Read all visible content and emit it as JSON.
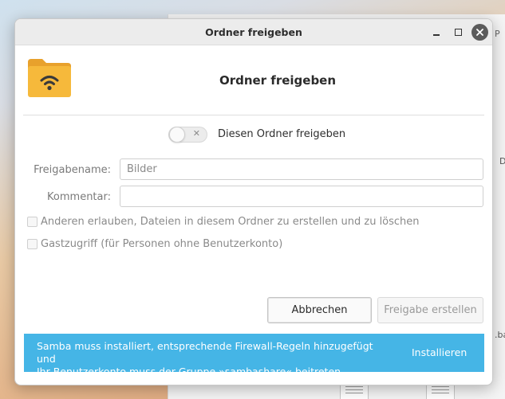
{
  "background": {
    "window_title_fragment": "P",
    "side_letter": "D",
    "side_ext": ".ba"
  },
  "dialog": {
    "title": "Ordner freigeben",
    "heading": "Ordner freigeben",
    "toggle": {
      "label": "Diesen Ordner freigeben",
      "on": false,
      "off_glyph": "✕"
    },
    "fields": {
      "share_name": {
        "label": "Freigabename:",
        "placeholder": "Bilder",
        "value": ""
      },
      "comment": {
        "label": "Kommentar:",
        "placeholder": "",
        "value": ""
      }
    },
    "checks": {
      "allow_others": "Anderen erlauben, Dateien in diesem Ordner zu erstellen und zu löschen",
      "guest_access": "Gastzugriff (für Personen ohne Benutzerkonto)"
    },
    "buttons": {
      "cancel": "Abbrechen",
      "create": "Freigabe erstellen"
    },
    "infobar": {
      "line1": "Samba muss installiert, entsprechende Firewall-Regeln hinzugefügt und",
      "line2": "Ihr Benutzerkonto muss der Gruppe »sambashare« beitreten.",
      "action": "Installieren",
      "color": "#45b5e6"
    },
    "window_controls": {
      "close_glyph": "✕"
    }
  },
  "colors": {
    "folder_body": "#f6b93b",
    "folder_tab": "#e8a12c",
    "wifi": "#3a3a3a"
  }
}
